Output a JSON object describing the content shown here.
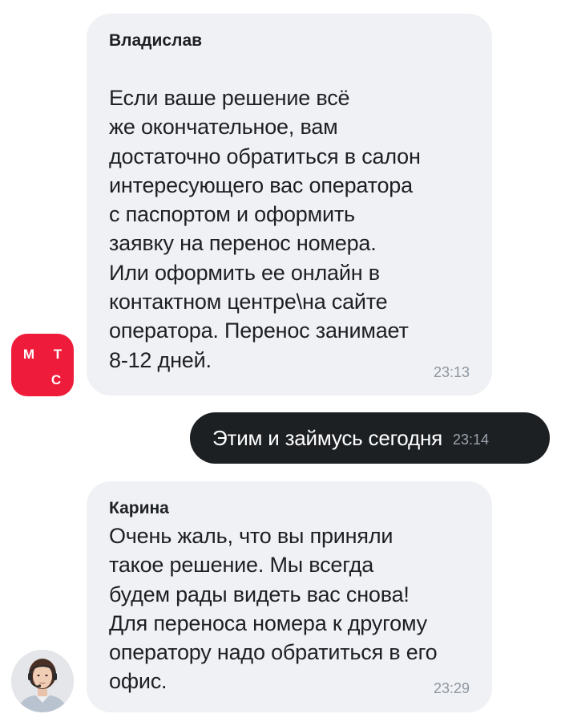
{
  "chat": {
    "messages": [
      {
        "sender": "Владислав",
        "text": "Если ваше решение всё\nже окончательное, вам\nдостаточно обратиться в салон\nинтересующего вас оператора\nс паспортом и оформить\nзаявку на перенос номера.\nИли оформить ее онлайн в\nконтактном центре\\на сайте\nоператора. Перенос занимает\n8-12 дней.",
        "time": "23:13",
        "avatar": {
          "icon": "mts-logo-icon",
          "letters": [
            "М",
            "Т",
            "С"
          ],
          "color": "#ee1c3a"
        }
      },
      {
        "text": "Этим и займусь сегодня",
        "time": "23:14"
      },
      {
        "sender": "Карина",
        "text": "Очень жаль, что вы приняли\nтакое решение. Мы всегда\nбудем рады видеть вас снова!\nДля переноса номера к другому\nоператору надо обратиться в его\nофис.",
        "time": "23:29",
        "avatar": {
          "icon": "operator-photo-icon"
        }
      }
    ]
  },
  "colors": {
    "incoming_bubble": "#f0f1f4",
    "outgoing_bubble": "#1d2023",
    "text": "#1d2023",
    "time": "#8d96a0",
    "mts_red": "#ee1c3a"
  }
}
